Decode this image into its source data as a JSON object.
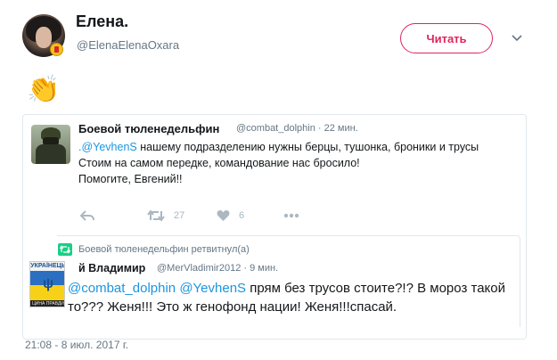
{
  "tweet": {
    "author_name": "Елена.",
    "author_handle": "@ElenaElenaOxara",
    "follow_label": "Читать",
    "emoji": "👏",
    "timestamp": "21:08 - 8 июл. 2017 г."
  },
  "quoted": {
    "author_name": "Боевой тюленедельфин",
    "author_handle": "@combat_dolphin · 22 мин.",
    "mention": ".@YevhenS",
    "line1_rest": " нашему подразделению нужны берцы, тушонка, броники и трусы",
    "line2": "Стоим на самом передке, командование нас бросило!",
    "line3": "Помогите, Евгений!!",
    "retweet_count": "27",
    "like_count": "6"
  },
  "retweet": {
    "notice": "Боевой тюленедельфин ретвитнул(а)",
    "author_name": "й Владимир",
    "author_handle": "@MerVladimir2012 · 9 мин.",
    "mention1": "@combat_dolphin",
    "mention2": "@YevhenS",
    "text_rest": " прям без трусов стоите?!? В мороз такой то??? Женя!!! Это ж генофонд нации! Женя!!!спасай.",
    "avatar_top_text": "УКРАЇНЕЦЬ",
    "avatar_bottom_text": "ЦИНА ПРАВДИ"
  },
  "colors": {
    "follow_accent": "#e0245e",
    "mention": "#1b95e0",
    "secondary_text": "#657786",
    "action_icons": "#aab8c2"
  },
  "icons": [
    "chevron-down-icon",
    "reply-icon",
    "retweet-icon",
    "like-icon",
    "more-icon",
    "retweet-notice-icon"
  ]
}
